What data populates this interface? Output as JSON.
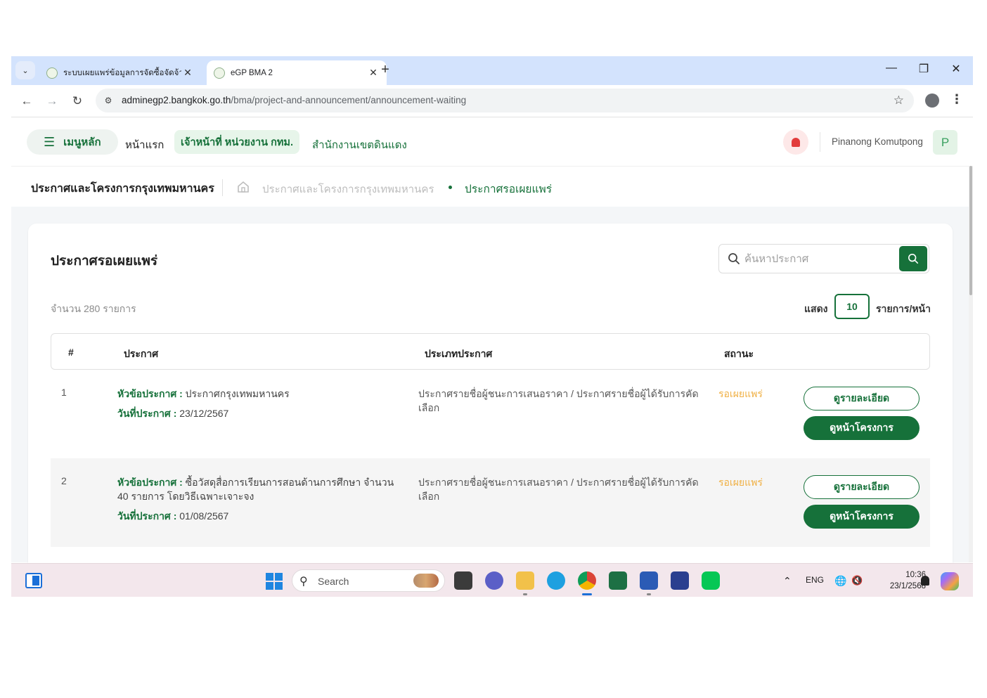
{
  "browser": {
    "tabs": [
      {
        "title": "ระบบเผยแพร่ข้อมูลการจัดซื้อจัดจ้างภ",
        "active": false
      },
      {
        "title": "eGP BMA 2",
        "active": true
      }
    ],
    "url_host": "adminegp2.bangkok.go.th",
    "url_path": "/bma/project-and-announcement/announcement-waiting"
  },
  "header": {
    "menu_label": "เมนูหลัก",
    "home_label": "หน้าแรก",
    "role_label": "เจ้าหน้าที่ หน่วยงาน กทม.",
    "office_label": "สำนักงานเขตดินแดง",
    "user_name": "Pinanong Komutpong",
    "user_initial": "P"
  },
  "breadcrumb": {
    "title": "ประกาศและโครงการกรุงเทพมหานคร",
    "parent": "ประกาศและโครงการกรุงเทพมหานคร",
    "current": "ประกาศรอเผยแพร่"
  },
  "page": {
    "title": "ประกาศรอเผยแพร่",
    "search_placeholder": "ค้นหาประกาศ",
    "count_text": "จำนวน  280  รายการ",
    "show_label": "แสดง",
    "per_page": "10",
    "per_page_suffix": "รายการ/หน้า"
  },
  "table": {
    "headers": {
      "no": "#",
      "announcement": "ประกาศ",
      "type": "ประเภทประกาศ",
      "status": "สถานะ"
    },
    "subject_label": "หัวข้อประกาศ :",
    "date_label": "วันที่ประกาศ :",
    "view_detail_label": "ดูรายละเอียด",
    "view_project_label": "ดูหน้าโครงการ",
    "rows": [
      {
        "no": "1",
        "subject": "ประกาศกรุงเทพมหานคร",
        "date": "23/12/2567",
        "type": "ประกาศรายชื่อผู้ชนะการเสนอราคา / ประกาศรายชื่อผู้ได้รับการคัดเลือก",
        "status": "รอเผยแพร่"
      },
      {
        "no": "2",
        "subject": "ซื้อวัสดุสื่อการเรียนการสอนด้านการศึกษา จำนวน 40 รายการ โดยวิธีเฉพาะเจาะจง",
        "date": "01/08/2567",
        "type": "ประกาศรายชื่อผู้ชนะการเสนอราคา / ประกาศรายชื่อผู้ได้รับการคัดเลือก",
        "status": "รอเผยแพร่"
      }
    ]
  },
  "taskbar": {
    "search_label": "Search",
    "lang": "ENG",
    "time": "10:36",
    "date": "23/1/2568"
  },
  "colors": {
    "brand_green": "#16713a",
    "status_pending": "#f0b044",
    "alert_red": "#e23b3b"
  },
  "icons": [
    "chevron-down-icon",
    "favicon-icon",
    "close-icon",
    "plus-icon",
    "minimize-icon",
    "restore-icon",
    "back-icon",
    "forward-icon",
    "reload-icon",
    "site-info-icon",
    "star-icon",
    "profile-icon",
    "kebab-icon",
    "hamburger-icon",
    "bell-icon",
    "home-icon",
    "search-icon"
  ]
}
